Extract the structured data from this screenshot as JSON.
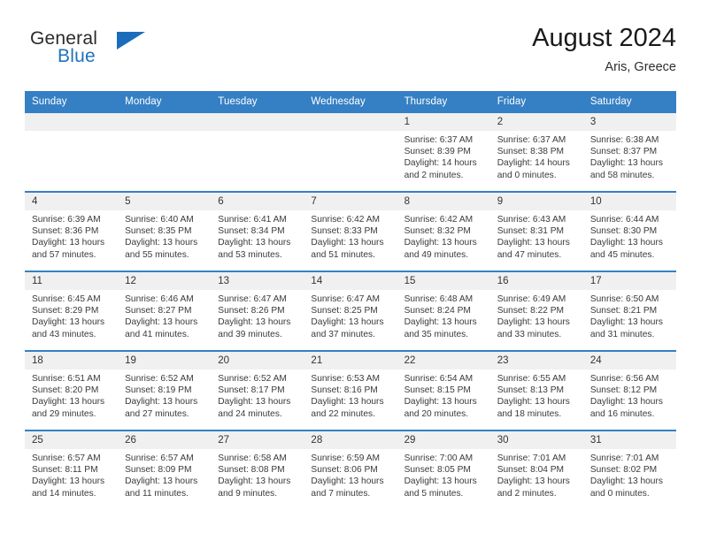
{
  "brand": {
    "name_part1": "General",
    "name_part2": "Blue",
    "flag_icon": "blue-triangle-flag-icon",
    "accent_color": "#1b6dbb"
  },
  "header": {
    "title": "August 2024",
    "subtitle": "Aris, Greece"
  },
  "theme": {
    "header_row_color": "#3580c4",
    "daynum_band_color": "#f0f0f0",
    "text_color": "#3a3a3a"
  },
  "calendar": {
    "weekday_headers": [
      "Sunday",
      "Monday",
      "Tuesday",
      "Wednesday",
      "Thursday",
      "Friday",
      "Saturday"
    ],
    "labels": {
      "sunrise": "Sunrise:",
      "sunset": "Sunset:",
      "daylight": "Daylight:"
    },
    "weeks": [
      [
        {
          "day": "",
          "empty": true,
          "sunrise": "",
          "sunset": "",
          "daylight": ""
        },
        {
          "day": "",
          "empty": true,
          "sunrise": "",
          "sunset": "",
          "daylight": ""
        },
        {
          "day": "",
          "empty": true,
          "sunrise": "",
          "sunset": "",
          "daylight": ""
        },
        {
          "day": "",
          "empty": true,
          "sunrise": "",
          "sunset": "",
          "daylight": ""
        },
        {
          "day": "1",
          "empty": false,
          "sunrise": "Sunrise: 6:37 AM",
          "sunset": "Sunset: 8:39 PM",
          "daylight": "Daylight: 14 hours and 2 minutes."
        },
        {
          "day": "2",
          "empty": false,
          "sunrise": "Sunrise: 6:37 AM",
          "sunset": "Sunset: 8:38 PM",
          "daylight": "Daylight: 14 hours and 0 minutes."
        },
        {
          "day": "3",
          "empty": false,
          "sunrise": "Sunrise: 6:38 AM",
          "sunset": "Sunset: 8:37 PM",
          "daylight": "Daylight: 13 hours and 58 minutes."
        }
      ],
      [
        {
          "day": "4",
          "empty": false,
          "sunrise": "Sunrise: 6:39 AM",
          "sunset": "Sunset: 8:36 PM",
          "daylight": "Daylight: 13 hours and 57 minutes."
        },
        {
          "day": "5",
          "empty": false,
          "sunrise": "Sunrise: 6:40 AM",
          "sunset": "Sunset: 8:35 PM",
          "daylight": "Daylight: 13 hours and 55 minutes."
        },
        {
          "day": "6",
          "empty": false,
          "sunrise": "Sunrise: 6:41 AM",
          "sunset": "Sunset: 8:34 PM",
          "daylight": "Daylight: 13 hours and 53 minutes."
        },
        {
          "day": "7",
          "empty": false,
          "sunrise": "Sunrise: 6:42 AM",
          "sunset": "Sunset: 8:33 PM",
          "daylight": "Daylight: 13 hours and 51 minutes."
        },
        {
          "day": "8",
          "empty": false,
          "sunrise": "Sunrise: 6:42 AM",
          "sunset": "Sunset: 8:32 PM",
          "daylight": "Daylight: 13 hours and 49 minutes."
        },
        {
          "day": "9",
          "empty": false,
          "sunrise": "Sunrise: 6:43 AM",
          "sunset": "Sunset: 8:31 PM",
          "daylight": "Daylight: 13 hours and 47 minutes."
        },
        {
          "day": "10",
          "empty": false,
          "sunrise": "Sunrise: 6:44 AM",
          "sunset": "Sunset: 8:30 PM",
          "daylight": "Daylight: 13 hours and 45 minutes."
        }
      ],
      [
        {
          "day": "11",
          "empty": false,
          "sunrise": "Sunrise: 6:45 AM",
          "sunset": "Sunset: 8:29 PM",
          "daylight": "Daylight: 13 hours and 43 minutes."
        },
        {
          "day": "12",
          "empty": false,
          "sunrise": "Sunrise: 6:46 AM",
          "sunset": "Sunset: 8:27 PM",
          "daylight": "Daylight: 13 hours and 41 minutes."
        },
        {
          "day": "13",
          "empty": false,
          "sunrise": "Sunrise: 6:47 AM",
          "sunset": "Sunset: 8:26 PM",
          "daylight": "Daylight: 13 hours and 39 minutes."
        },
        {
          "day": "14",
          "empty": false,
          "sunrise": "Sunrise: 6:47 AM",
          "sunset": "Sunset: 8:25 PM",
          "daylight": "Daylight: 13 hours and 37 minutes."
        },
        {
          "day": "15",
          "empty": false,
          "sunrise": "Sunrise: 6:48 AM",
          "sunset": "Sunset: 8:24 PM",
          "daylight": "Daylight: 13 hours and 35 minutes."
        },
        {
          "day": "16",
          "empty": false,
          "sunrise": "Sunrise: 6:49 AM",
          "sunset": "Sunset: 8:22 PM",
          "daylight": "Daylight: 13 hours and 33 minutes."
        },
        {
          "day": "17",
          "empty": false,
          "sunrise": "Sunrise: 6:50 AM",
          "sunset": "Sunset: 8:21 PM",
          "daylight": "Daylight: 13 hours and 31 minutes."
        }
      ],
      [
        {
          "day": "18",
          "empty": false,
          "sunrise": "Sunrise: 6:51 AM",
          "sunset": "Sunset: 8:20 PM",
          "daylight": "Daylight: 13 hours and 29 minutes."
        },
        {
          "day": "19",
          "empty": false,
          "sunrise": "Sunrise: 6:52 AM",
          "sunset": "Sunset: 8:19 PM",
          "daylight": "Daylight: 13 hours and 27 minutes."
        },
        {
          "day": "20",
          "empty": false,
          "sunrise": "Sunrise: 6:52 AM",
          "sunset": "Sunset: 8:17 PM",
          "daylight": "Daylight: 13 hours and 24 minutes."
        },
        {
          "day": "21",
          "empty": false,
          "sunrise": "Sunrise: 6:53 AM",
          "sunset": "Sunset: 8:16 PM",
          "daylight": "Daylight: 13 hours and 22 minutes."
        },
        {
          "day": "22",
          "empty": false,
          "sunrise": "Sunrise: 6:54 AM",
          "sunset": "Sunset: 8:15 PM",
          "daylight": "Daylight: 13 hours and 20 minutes."
        },
        {
          "day": "23",
          "empty": false,
          "sunrise": "Sunrise: 6:55 AM",
          "sunset": "Sunset: 8:13 PM",
          "daylight": "Daylight: 13 hours and 18 minutes."
        },
        {
          "day": "24",
          "empty": false,
          "sunrise": "Sunrise: 6:56 AM",
          "sunset": "Sunset: 8:12 PM",
          "daylight": "Daylight: 13 hours and 16 minutes."
        }
      ],
      [
        {
          "day": "25",
          "empty": false,
          "sunrise": "Sunrise: 6:57 AM",
          "sunset": "Sunset: 8:11 PM",
          "daylight": "Daylight: 13 hours and 14 minutes."
        },
        {
          "day": "26",
          "empty": false,
          "sunrise": "Sunrise: 6:57 AM",
          "sunset": "Sunset: 8:09 PM",
          "daylight": "Daylight: 13 hours and 11 minutes."
        },
        {
          "day": "27",
          "empty": false,
          "sunrise": "Sunrise: 6:58 AM",
          "sunset": "Sunset: 8:08 PM",
          "daylight": "Daylight: 13 hours and 9 minutes."
        },
        {
          "day": "28",
          "empty": false,
          "sunrise": "Sunrise: 6:59 AM",
          "sunset": "Sunset: 8:06 PM",
          "daylight": "Daylight: 13 hours and 7 minutes."
        },
        {
          "day": "29",
          "empty": false,
          "sunrise": "Sunrise: 7:00 AM",
          "sunset": "Sunset: 8:05 PM",
          "daylight": "Daylight: 13 hours and 5 minutes."
        },
        {
          "day": "30",
          "empty": false,
          "sunrise": "Sunrise: 7:01 AM",
          "sunset": "Sunset: 8:04 PM",
          "daylight": "Daylight: 13 hours and 2 minutes."
        },
        {
          "day": "31",
          "empty": false,
          "sunrise": "Sunrise: 7:01 AM",
          "sunset": "Sunset: 8:02 PM",
          "daylight": "Daylight: 13 hours and 0 minutes."
        }
      ]
    ]
  }
}
